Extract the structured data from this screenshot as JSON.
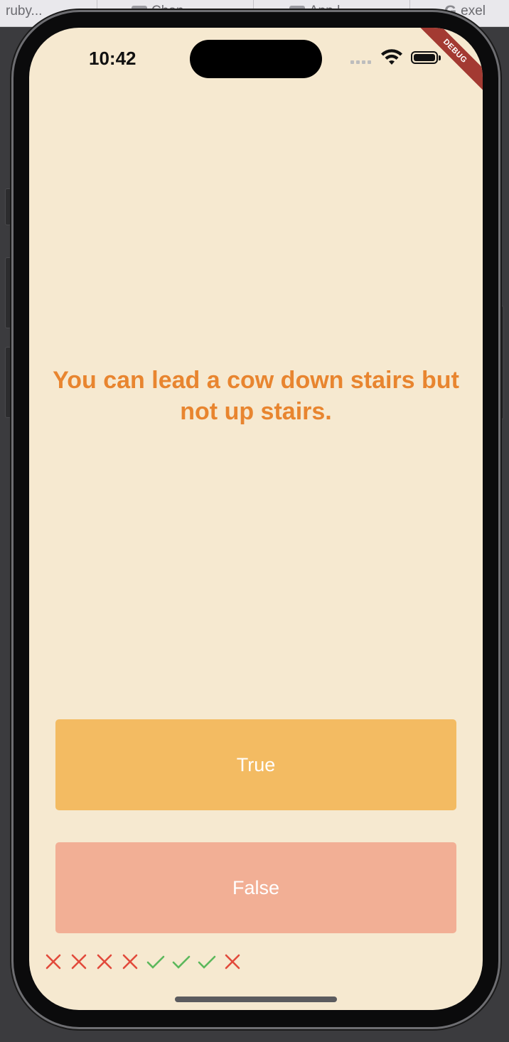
{
  "browser_tabs": [
    {
      "label": "ruby...",
      "icon": "none"
    },
    {
      "label": "Chan",
      "icon": "tab-icon"
    },
    {
      "label": "App l",
      "icon": "tab-icon"
    },
    {
      "label": "exel",
      "icon": "google-icon"
    }
  ],
  "status_bar": {
    "time": "10:42",
    "debug_label": "DEBUG"
  },
  "quiz": {
    "question": "You can lead a cow down stairs but not up stairs.",
    "true_label": "True",
    "false_label": "False"
  },
  "score_keeper": [
    {
      "result": "wrong",
      "icon": "close-icon",
      "color": "#e24a3b"
    },
    {
      "result": "wrong",
      "icon": "close-icon",
      "color": "#e24a3b"
    },
    {
      "result": "wrong",
      "icon": "close-icon",
      "color": "#e24a3b"
    },
    {
      "result": "wrong",
      "icon": "close-icon",
      "color": "#e24a3b"
    },
    {
      "result": "right",
      "icon": "check-icon",
      "color": "#5cb85c"
    },
    {
      "result": "right",
      "icon": "check-icon",
      "color": "#5cb85c"
    },
    {
      "result": "right",
      "icon": "check-icon",
      "color": "#5cb85c"
    },
    {
      "result": "wrong",
      "icon": "close-icon",
      "color": "#e24a3b"
    }
  ],
  "colors": {
    "background": "#f6e9d0",
    "question_text": "#e8852f",
    "true_button": "#f3bb62",
    "false_button": "#f2af95",
    "debug_banner": "#a33a32"
  }
}
